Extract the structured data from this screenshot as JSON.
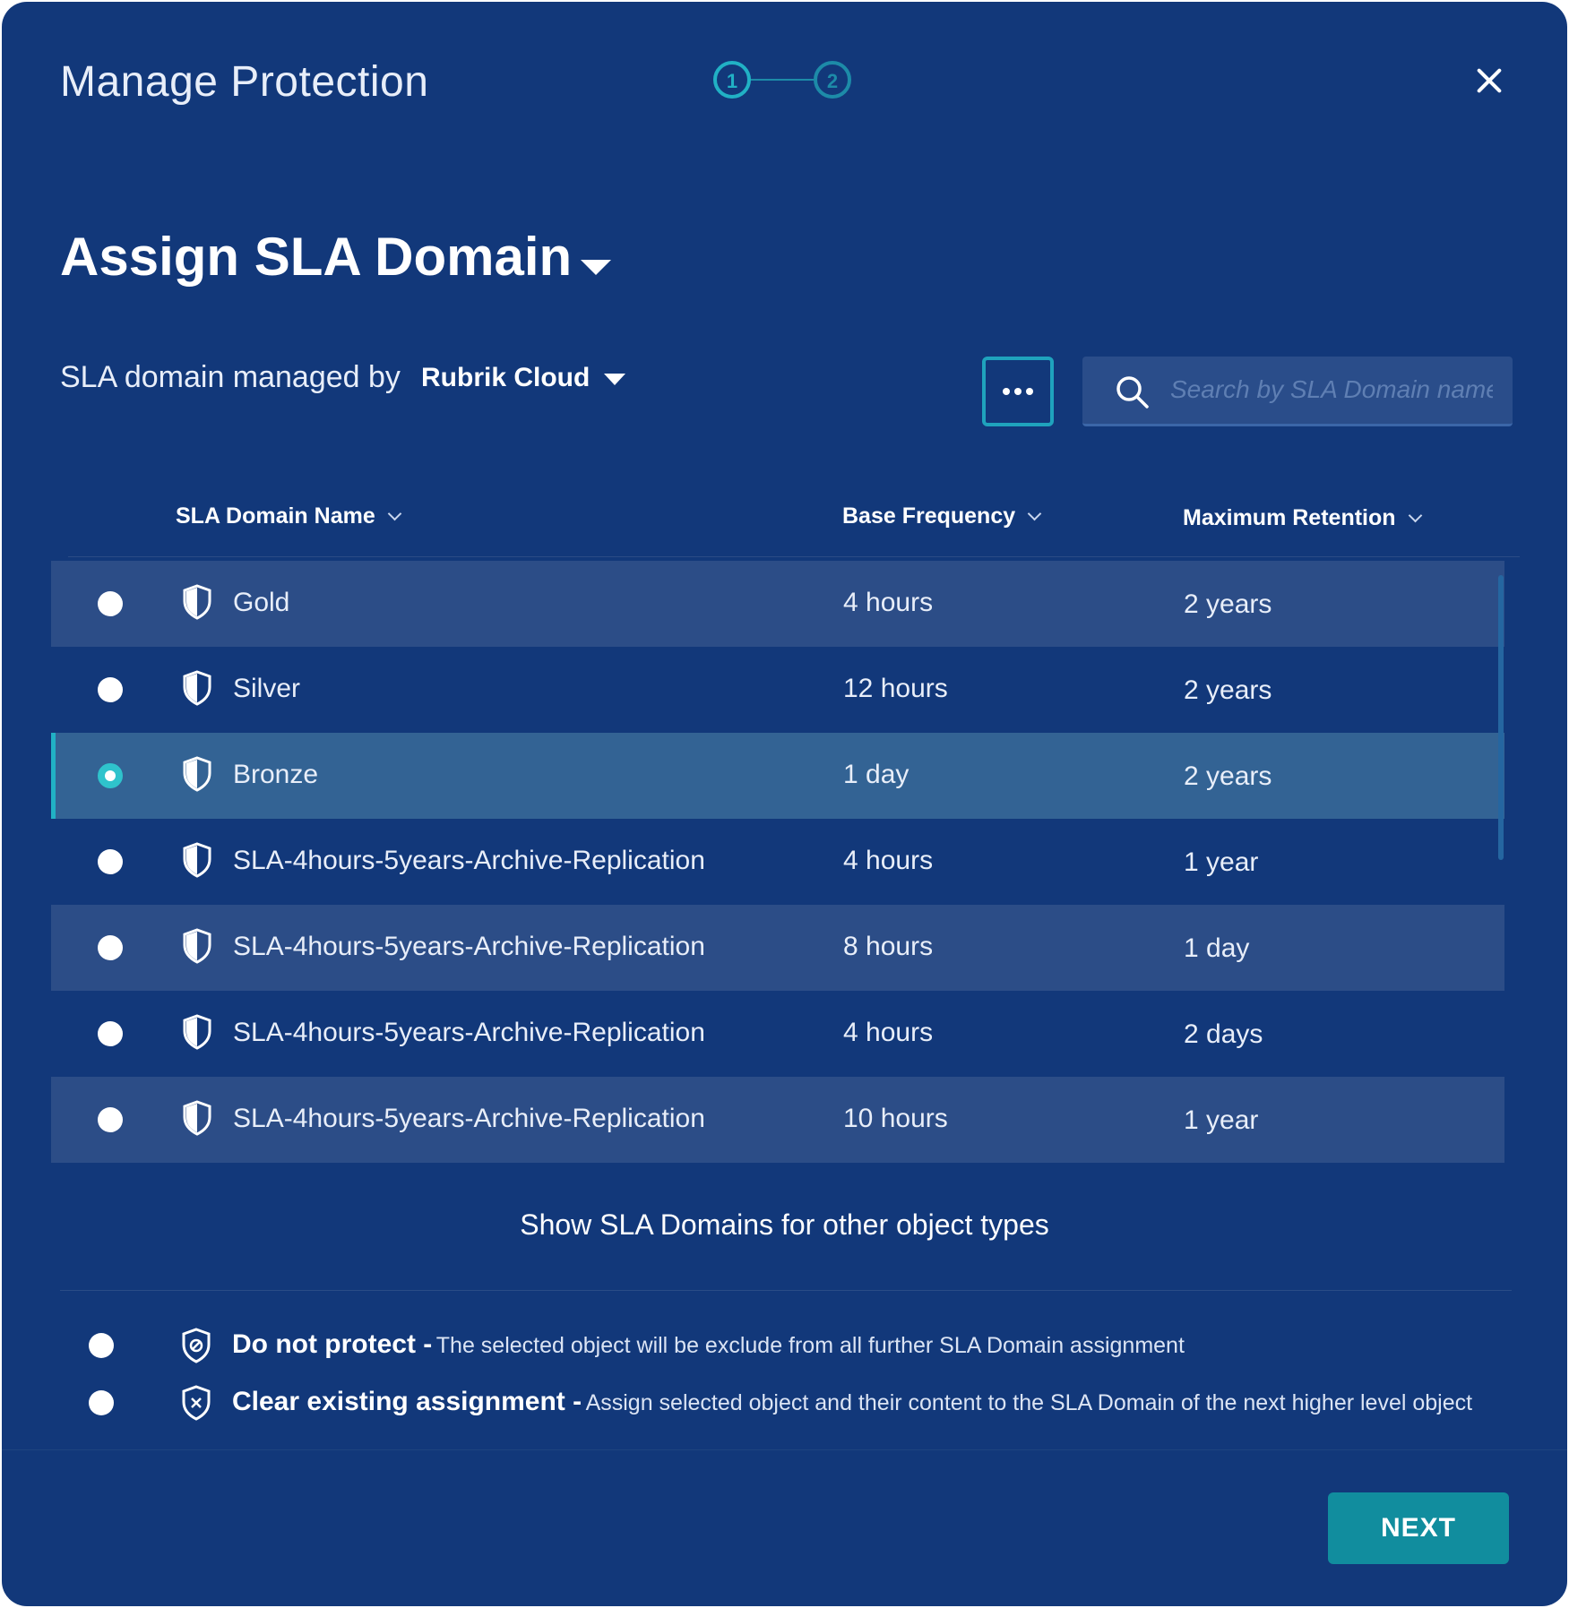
{
  "dialog": {
    "title": "Manage Protection",
    "steps": [
      "1",
      "2"
    ],
    "active_step": 1
  },
  "heading": "Assign SLA Domain",
  "managed_by": {
    "label": "SLA domain managed by",
    "value": "Rubrik Cloud"
  },
  "search": {
    "placeholder": "Search by SLA Domain name",
    "value": ""
  },
  "table": {
    "columns": [
      "SLA Domain Name",
      "Base Frequency",
      "Maximum Retention"
    ],
    "rows": [
      {
        "name": "Gold",
        "frequency": "4 hours",
        "retention": "2 years",
        "selected": false
      },
      {
        "name": "Silver",
        "frequency": "12 hours",
        "retention": "2 years",
        "selected": false
      },
      {
        "name": "Bronze",
        "frequency": "1 day",
        "retention": "2 years",
        "selected": true
      },
      {
        "name": "SLA-4hours-5years-Archive-Replication",
        "frequency": "4 hours",
        "retention": "1 year",
        "selected": false
      },
      {
        "name": "SLA-4hours-5years-Archive-Replication",
        "frequency": "8 hours",
        "retention": "1 day",
        "selected": false
      },
      {
        "name": "SLA-4hours-5years-Archive-Replication",
        "frequency": "4 hours",
        "retention": "2 days",
        "selected": false
      },
      {
        "name": "SLA-4hours-5years-Archive-Replication",
        "frequency": "10 hours",
        "retention": "1 year",
        "selected": false
      }
    ]
  },
  "show_other_link": "Show SLA Domains for other object types",
  "options": {
    "do_not_protect": {
      "title": "Do not protect -",
      "description": "The selected object will be exclude from all further SLA Domain assignment"
    },
    "clear_assignment": {
      "title": "Clear existing assignment -",
      "description": "Assign selected object and their content to the SLA Domain of the next higher level object"
    }
  },
  "next_label": "NEXT",
  "colors": {
    "background": "#12387a",
    "accent": "#21b1c5",
    "row_alt": "#2c4d87",
    "row_selected": "#336394",
    "button": "#118d9e"
  }
}
